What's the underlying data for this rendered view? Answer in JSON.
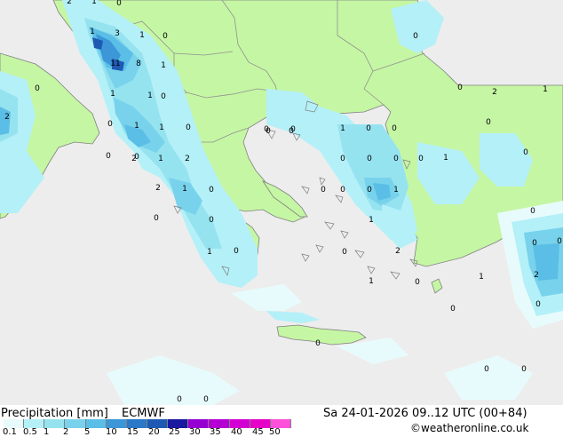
{
  "header": {
    "title": "Precipitation [mm]",
    "model": "ECMWF",
    "datetime": "Sa 24-01-2026 09..12 UTC (00+84)",
    "credit": "©weatheronline.co.uk"
  },
  "colors": {
    "sea": "#ededed",
    "land": "#c5f6a4",
    "border": "#909090",
    "coast": "#808080"
  },
  "legend": {
    "ticks": [
      "0.1",
      "0.5",
      "1",
      "2",
      "5",
      "10",
      "15",
      "20",
      "25",
      "30",
      "35",
      "40",
      "45",
      "50"
    ],
    "swatches": [
      "#e8fbfc",
      "#b4f0f8",
      "#96e3f0",
      "#78d2ec",
      "#5abee6",
      "#3c96d8",
      "#2a78c8",
      "#1e5ab4",
      "#1a1aa0",
      "#9600d2",
      "#b400d2",
      "#d200d2",
      "#e600c8",
      "#ff50dc"
    ]
  },
  "point_values": [
    {
      "label": "2"
    },
    {
      "label": "1"
    },
    {
      "label": "0"
    },
    {
      "label": "1"
    },
    {
      "label": "3"
    },
    {
      "label": "1"
    },
    {
      "label": "0"
    },
    {
      "label": "11"
    },
    {
      "label": "8"
    },
    {
      "label": "1"
    },
    {
      "label": "1"
    },
    {
      "label": "0"
    },
    {
      "label": "1"
    },
    {
      "label": "0"
    },
    {
      "label": "0"
    },
    {
      "label": "1"
    },
    {
      "label": "0"
    },
    {
      "label": "2"
    },
    {
      "label": "1"
    },
    {
      "label": "0"
    },
    {
      "label": "0"
    },
    {
      "label": "2"
    },
    {
      "label": "1"
    },
    {
      "label": "2"
    },
    {
      "label": "0"
    },
    {
      "label": "0"
    },
    {
      "label": "2"
    },
    {
      "label": "1"
    },
    {
      "label": "0"
    },
    {
      "label": "0"
    },
    {
      "label": "1"
    },
    {
      "label": "0"
    },
    {
      "label": "0"
    },
    {
      "label": "1"
    },
    {
      "label": "0"
    },
    {
      "label": "0"
    },
    {
      "label": "0"
    },
    {
      "label": "0"
    },
    {
      "label": "0"
    },
    {
      "label": "0"
    },
    {
      "label": "1"
    },
    {
      "label": "0"
    },
    {
      "label": "0"
    },
    {
      "label": "0"
    },
    {
      "label": "1"
    },
    {
      "label": "1"
    },
    {
      "label": "0"
    },
    {
      "label": "2"
    },
    {
      "label": "1"
    },
    {
      "label": "1"
    },
    {
      "label": "0"
    },
    {
      "label": "0"
    },
    {
      "label": "0"
    },
    {
      "label": "0"
    },
    {
      "label": "0"
    },
    {
      "label": "0"
    },
    {
      "label": "0"
    },
    {
      "label": "0"
    },
    {
      "label": "2"
    },
    {
      "label": "2"
    },
    {
      "label": "1"
    },
    {
      "label": "0"
    },
    {
      "label": "0"
    },
    {
      "label": "0"
    },
    {
      "label": "0"
    },
    {
      "label": "0"
    },
    {
      "label": "0"
    },
    {
      "label": "0"
    },
    {
      "label": "0"
    },
    {
      "label": "0"
    }
  ]
}
